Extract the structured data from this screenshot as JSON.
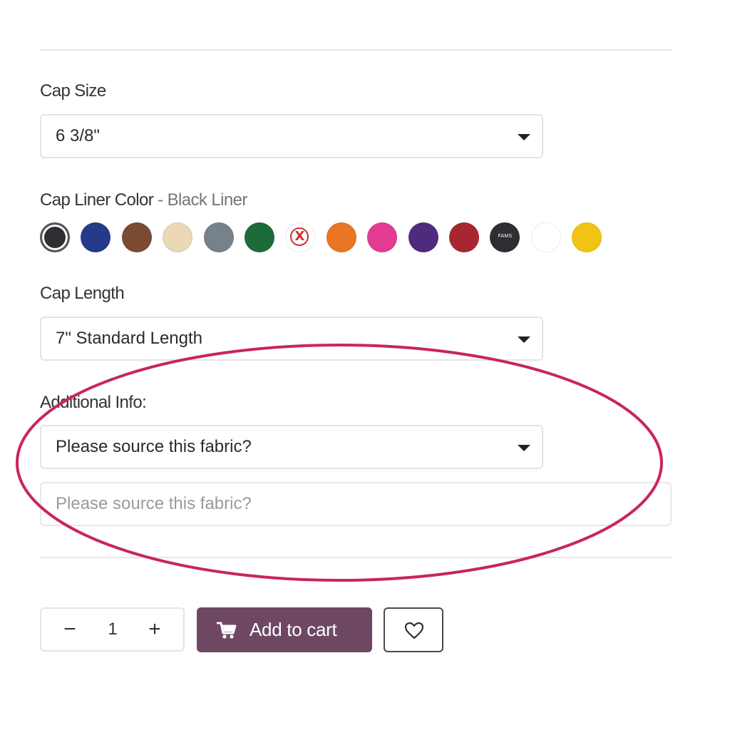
{
  "cap_size": {
    "label": "Cap Size",
    "selected": "6 3/8\""
  },
  "liner_color": {
    "label": "Cap Liner Color",
    "separator": " - ",
    "selected_name": "Black Liner",
    "swatches": [
      {
        "color": "#2f2f33",
        "selected": true
      },
      {
        "color": "#263a8c"
      },
      {
        "color": "#7a4a33"
      },
      {
        "color": "#ead9b4"
      },
      {
        "color": "#77818a"
      },
      {
        "color": "#1e6b3a"
      },
      {
        "color": "#ffffff",
        "icon": "no-liner-x-icon",
        "mark": "X"
      },
      {
        "color": "#ea7524"
      },
      {
        "color": "#e33b92"
      },
      {
        "color": "#4f2b7d"
      },
      {
        "color": "#a72630"
      },
      {
        "color": "#2f2f33",
        "badge": "FAMS"
      },
      {
        "color": "#ffffff"
      },
      {
        "color": "#f2c314"
      }
    ]
  },
  "cap_length": {
    "label": "Cap Length",
    "selected": "7\" Standard Length"
  },
  "additional_info": {
    "label": "Additional Info:",
    "selected": "Please source this fabric?",
    "text_placeholder": "Please source this fabric?"
  },
  "purchase": {
    "minus": "−",
    "quantity": "1",
    "plus": "+",
    "add_to_cart": "Add to cart",
    "cart_icon": "shopping-cart-icon",
    "wishlist_icon": "heart-icon",
    "accent_color": "#6e4863"
  },
  "annotation": {
    "shape": "ellipse",
    "color": "#c8265a"
  }
}
